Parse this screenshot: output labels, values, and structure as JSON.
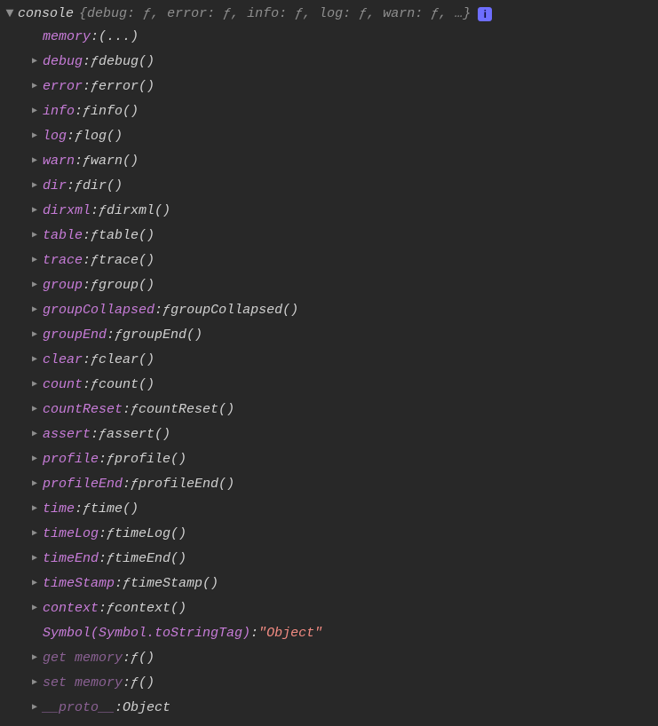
{
  "header": {
    "objectName": "console",
    "previewOpen": "{",
    "previewItems": [
      {
        "key": "debug",
        "sym": "ƒ"
      },
      {
        "key": "error",
        "sym": "ƒ"
      },
      {
        "key": "info",
        "sym": "ƒ"
      },
      {
        "key": "log",
        "sym": "ƒ"
      },
      {
        "key": "warn",
        "sym": "ƒ"
      }
    ],
    "previewEllipsis": "…",
    "previewClose": "}",
    "infoGlyph": "i"
  },
  "rows": [
    {
      "expandable": false,
      "keyClass": "key",
      "key": "memory",
      "valueType": "plain",
      "value": "(...)"
    },
    {
      "expandable": true,
      "keyClass": "key",
      "key": "debug",
      "valueType": "func",
      "fname": "debug()"
    },
    {
      "expandable": true,
      "keyClass": "key",
      "key": "error",
      "valueType": "func",
      "fname": "error()"
    },
    {
      "expandable": true,
      "keyClass": "key",
      "key": "info",
      "valueType": "func",
      "fname": "info()"
    },
    {
      "expandable": true,
      "keyClass": "key",
      "key": "log",
      "valueType": "func",
      "fname": "log()"
    },
    {
      "expandable": true,
      "keyClass": "key",
      "key": "warn",
      "valueType": "func",
      "fname": "warn()"
    },
    {
      "expandable": true,
      "keyClass": "key",
      "key": "dir",
      "valueType": "func",
      "fname": "dir()"
    },
    {
      "expandable": true,
      "keyClass": "key",
      "key": "dirxml",
      "valueType": "func",
      "fname": "dirxml()"
    },
    {
      "expandable": true,
      "keyClass": "key",
      "key": "table",
      "valueType": "func",
      "fname": "table()"
    },
    {
      "expandable": true,
      "keyClass": "key",
      "key": "trace",
      "valueType": "func",
      "fname": "trace()"
    },
    {
      "expandable": true,
      "keyClass": "key",
      "key": "group",
      "valueType": "func",
      "fname": "group()"
    },
    {
      "expandable": true,
      "keyClass": "key",
      "key": "groupCollapsed",
      "valueType": "func",
      "fname": "groupCollapsed()"
    },
    {
      "expandable": true,
      "keyClass": "key",
      "key": "groupEnd",
      "valueType": "func",
      "fname": "groupEnd()"
    },
    {
      "expandable": true,
      "keyClass": "key",
      "key": "clear",
      "valueType": "func",
      "fname": "clear()"
    },
    {
      "expandable": true,
      "keyClass": "key",
      "key": "count",
      "valueType": "func",
      "fname": "count()"
    },
    {
      "expandable": true,
      "keyClass": "key",
      "key": "countReset",
      "valueType": "func",
      "fname": "countReset()"
    },
    {
      "expandable": true,
      "keyClass": "key",
      "key": "assert",
      "valueType": "func",
      "fname": "assert()"
    },
    {
      "expandable": true,
      "keyClass": "key",
      "key": "profile",
      "valueType": "func",
      "fname": "profile()"
    },
    {
      "expandable": true,
      "keyClass": "key",
      "key": "profileEnd",
      "valueType": "func",
      "fname": "profileEnd()"
    },
    {
      "expandable": true,
      "keyClass": "key",
      "key": "time",
      "valueType": "func",
      "fname": "time()"
    },
    {
      "expandable": true,
      "keyClass": "key",
      "key": "timeLog",
      "valueType": "func",
      "fname": "timeLog()"
    },
    {
      "expandable": true,
      "keyClass": "key",
      "key": "timeEnd",
      "valueType": "func",
      "fname": "timeEnd()"
    },
    {
      "expandable": true,
      "keyClass": "key",
      "key": "timeStamp",
      "valueType": "func",
      "fname": "timeStamp()"
    },
    {
      "expandable": true,
      "keyClass": "key",
      "key": "context",
      "valueType": "func",
      "fname": "context()"
    },
    {
      "expandable": false,
      "keyClass": "symbol-key",
      "key": "Symbol(Symbol.toStringTag)",
      "valueType": "string",
      "value": "\"Object\""
    },
    {
      "expandable": true,
      "keyClass": "key-faded",
      "key": "get memory",
      "valueType": "func",
      "fname": "()"
    },
    {
      "expandable": true,
      "keyClass": "key-faded",
      "key": "set memory",
      "valueType": "func",
      "fname": "()"
    },
    {
      "expandable": true,
      "keyClass": "key-faded",
      "key": "__proto__",
      "valueType": "plain",
      "value": "Object"
    }
  ],
  "glyphs": {
    "down": "▼",
    "right": "▶",
    "f": "ƒ"
  }
}
